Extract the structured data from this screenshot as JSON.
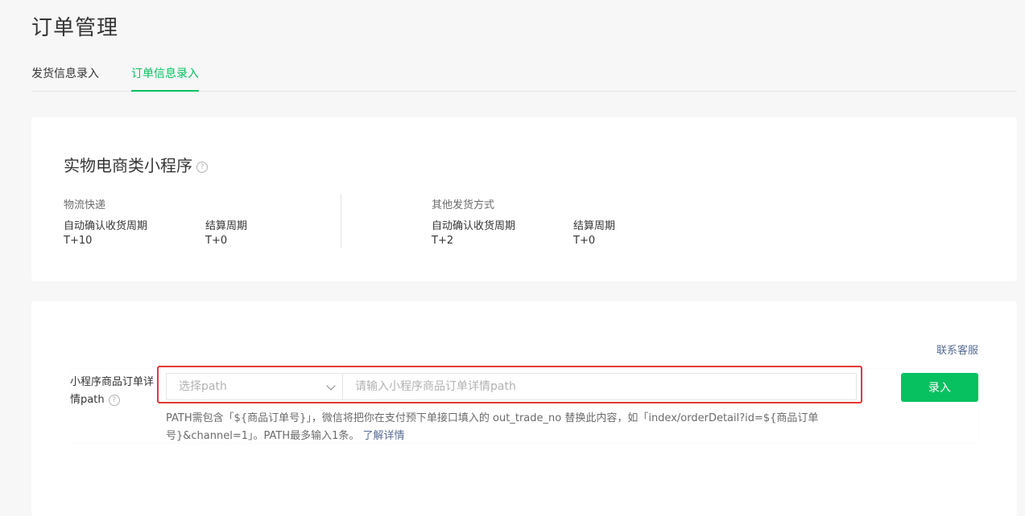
{
  "page": {
    "title": "订单管理"
  },
  "tabs": [
    {
      "label": "发货信息录入",
      "active": false
    },
    {
      "label": "订单信息录入",
      "active": true
    }
  ],
  "category": {
    "title": "实物电商类小程序",
    "help_icon": "question-circle-icon",
    "groups": [
      {
        "heading": "物流快递",
        "items": [
          {
            "label": "自动确认收货周期",
            "value": "T+10"
          },
          {
            "label": "结算周期",
            "value": "T+0"
          }
        ]
      },
      {
        "heading": "其他发货方式",
        "items": [
          {
            "label": "自动确认收货周期",
            "value": "T+2"
          },
          {
            "label": "结算周期",
            "value": "T+0"
          }
        ]
      }
    ]
  },
  "form": {
    "contact_label": "联系客服",
    "field_label": "小程序商品订单详情path",
    "select_placeholder": "选择path",
    "input_placeholder": "请输入小程序商品订单详情path",
    "submit_label": "录入",
    "note_text": "PATH需包含「${商品订单号}」，微信将把你在支付预下单接口填入的 out_trade_no 替换此内容，如「index/orderDetail?id=${商品订单号}&channel=1」。PATH最多输入1条。",
    "note_link": "了解详情"
  },
  "colors": {
    "accent": "#07c160",
    "link": "#576b95",
    "highlight": "#e53935"
  }
}
